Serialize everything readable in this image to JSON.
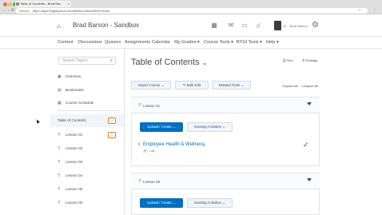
{
  "browser": {
    "tab_title": "Table of Contents - Brad Bar...",
    "tab_close": "×",
    "secure_label": "Secure",
    "url": "https://byui.brightspace.com/d2l/le/content/6031/Home",
    "back": "←",
    "forward": "→",
    "reload": "⟳",
    "star": "☆",
    "menu": "⋮"
  },
  "header": {
    "home_icon": "home-icon",
    "course_title": "Brad Barson - Sandbox",
    "icons": [
      "grid-icon",
      "mail-icon",
      "chat-icon",
      "bell-icon"
    ],
    "user_name": "Dr. - Brad Barson",
    "settings_icon": "gear-icon"
  },
  "navbar": {
    "items": [
      "Content",
      "Discussions",
      "Quizzes",
      "Assignments",
      "Calendar",
      "My Grades ▾",
      "Course Tools ▾",
      "BYUI Tools ▾",
      "Help ▾"
    ]
  },
  "sidebar": {
    "search_placeholder": "Search Topics",
    "search_icon": "🔍",
    "tools": [
      {
        "icon": "overview-icon",
        "glyph": "▣",
        "label": "Overview"
      },
      {
        "icon": "bookmark-icon",
        "glyph": "▤",
        "label": "Bookmarks"
      },
      {
        "icon": "calendar-icon",
        "glyph": "▦",
        "label": "Course Schedule"
      }
    ],
    "toc": {
      "label": "Table of Contents",
      "badge": "1"
    },
    "lessons": [
      {
        "label": "Lesson 01",
        "badge": "1"
      },
      {
        "label": "Lesson 02",
        "badge": ""
      },
      {
        "label": "Lesson 03",
        "badge": ""
      },
      {
        "label": "Lesson 04",
        "badge": ""
      },
      {
        "label": "Lesson 05",
        "badge": ""
      },
      {
        "label": "Lesson 06",
        "badge": ""
      }
    ],
    "handle_glyph": "⠿"
  },
  "main": {
    "title": "Table of Contents",
    "title_chevron": "⌄",
    "print": "Print",
    "settings": "Settings",
    "toolbar": {
      "import": "Import Course",
      "bulk_edit": "Bulk Edit",
      "related_tools": "Related Tools"
    },
    "expand_all": "Expand All",
    "collapse_all": "Collapse All",
    "modules": [
      {
        "label": "Lesson 01",
        "upload_create": "Upload / Create",
        "existing_activities": "Existing Activities",
        "topic": {
          "title": "Employee Health & Wellness",
          "type": "Link",
          "status": "✓"
        }
      },
      {
        "label": "Lesson 02",
        "upload_create": "Upload / Create",
        "existing_activities": "Existing Activities"
      }
    ]
  },
  "colors": {
    "primary_blue": "#006fbf",
    "badge_orange": "#e87511",
    "text": "#494c4e"
  }
}
